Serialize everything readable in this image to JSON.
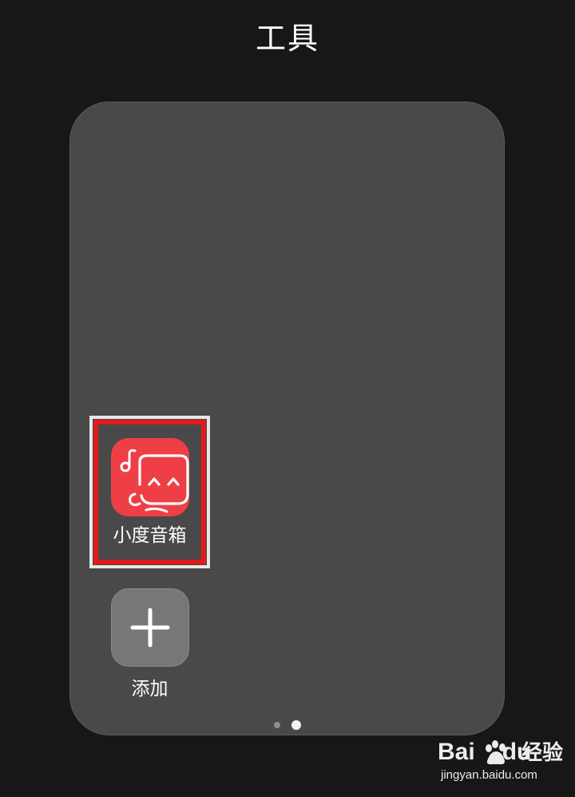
{
  "header": {
    "title": "工具"
  },
  "folder": {
    "apps": [
      {
        "label": "小度音箱",
        "icon": "xiaodu-speaker-icon",
        "highlighted": true,
        "icon_color": "#ee3f46"
      }
    ],
    "add": {
      "label": "添加",
      "icon": "plus-icon"
    },
    "page_indicator": {
      "total_pages": 2,
      "current_page": 2
    }
  },
  "highlight": {
    "color": "#e01b1b"
  },
  "watermark": {
    "brand_latin_1": "Bai",
    "brand_latin_2": "du",
    "brand_cn": "经验",
    "url": "jingyan.baidu.com"
  }
}
